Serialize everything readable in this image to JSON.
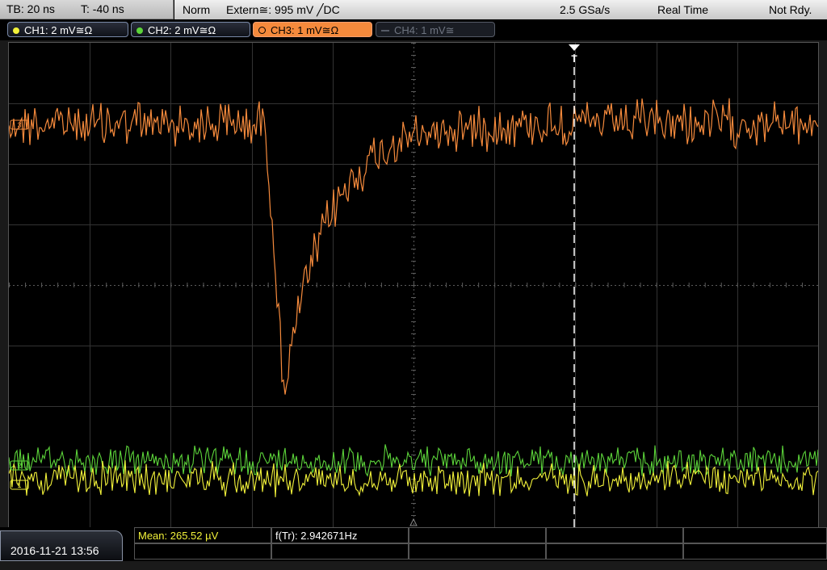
{
  "topbar": {
    "timebase": "TB: 20 ns",
    "trigger_offset": "T: -40 ns",
    "trigger_mode": "Norm",
    "trigger_source": "Extern≅: 995 mV ╱DC",
    "sample_rate": "2.5 GSa/s",
    "acquisition_mode": "Real Time",
    "state": "Not Rdy."
  },
  "channels": [
    {
      "label": "CH1: 2 mV≅Ω",
      "color": "#f2f23a",
      "state": "on"
    },
    {
      "label": "CH2: 2 mV≅Ω",
      "color": "#5cd43a",
      "state": "on"
    },
    {
      "label": "CH3: 1 mV≅Ω",
      "color": "#f58a3c",
      "state": "selected"
    },
    {
      "label": "CH4: 1 mV≅",
      "color": "#6e7480",
      "state": "off"
    }
  ],
  "markers": {
    "trigger_marker": "T",
    "ch1_marker": "1",
    "ch2_marker": "2",
    "ch3_marker": "3"
  },
  "bottombar": {
    "datetime": "2016-11-21 13:56",
    "mean": "Mean: 265.52 µV",
    "trigger_freq": "f(Tr): 2.942671Hz"
  },
  "colors": {
    "ch1": "#f2f23a",
    "ch2": "#5cd43a",
    "ch3": "#f58a3c",
    "grid": "#3a3a3a"
  }
}
